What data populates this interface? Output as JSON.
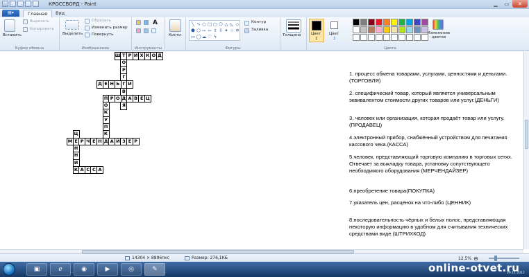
{
  "window": {
    "title": "КРОССВОРД - Paint"
  },
  "menu": {
    "file_tab": "▤▾",
    "tabs": [
      {
        "label": "Главная"
      },
      {
        "label": "Вид"
      }
    ]
  },
  "ribbon": {
    "clipboard": {
      "label": "Буфер обмена",
      "paste": "Вставить",
      "cut": "Вырезать",
      "copy": "Копировать"
    },
    "image": {
      "label": "Изображение",
      "select": "Выделить",
      "crop": "Обрезать",
      "resize": "Изменить размер",
      "rotate": "Повернуть"
    },
    "tools": {
      "label": "Инструменты",
      "text_tool": "A"
    },
    "brushes": {
      "label": "Кисти"
    },
    "shapes": {
      "label": "Фигуры",
      "outline": "Контур",
      "fill": "Заливка"
    },
    "size": {
      "label": "Толщина"
    },
    "colors": {
      "label": "Цвета",
      "color1": "Цвет",
      "color1_num": "1",
      "color2": "Цвет",
      "color2_num": "2",
      "edit": "Изменение цветов",
      "color1_value": "#000000",
      "color2_value": "#ffffff",
      "palette": [
        "#000000",
        "#7f7f7f",
        "#880015",
        "#ed1c24",
        "#ff7f27",
        "#fff200",
        "#22b14c",
        "#00a2e8",
        "#3f48cc",
        "#a349a4",
        "#ffffff",
        "#c3c3c3",
        "#b97a57",
        "#ffaec9",
        "#ffc90e",
        "#efe4b0",
        "#b5e61d",
        "#99d9ea",
        "#7092be",
        "#c8bfe7",
        "#ffffff",
        "#ffffff",
        "#ffffff",
        "#ffffff",
        "#ffffff",
        "#ffffff",
        "#ffffff",
        "#ffffff",
        "#ffffff",
        "#ffffff"
      ]
    }
  },
  "crossword": {
    "words": [
      {
        "id": "shtrikhkod",
        "text": "ШТРИХКОД",
        "dir": "across",
        "row": 0,
        "col": 8
      },
      {
        "id": "torgovlya",
        "text": "ТОРГОВЛЯ",
        "dir": "down",
        "row": 0,
        "col": 9
      },
      {
        "id": "dengi",
        "text": "ДЕНЬГИ",
        "dir": "across",
        "row": 4,
        "col": 5
      },
      {
        "id": "prodavets",
        "text": "ПРОДАВЕЦ",
        "dir": "across",
        "row": 6,
        "col": 6
      },
      {
        "id": "pokupka",
        "text": "ПОКУПКА",
        "dir": "down",
        "row": 6,
        "col": 6
      },
      {
        "id": "merchandayzer",
        "text": "МЕРЧЕНДАЙЗЕР",
        "dir": "across",
        "row": 12,
        "col": 0
      },
      {
        "id": "tsennik",
        "text": "ЦЕННИК",
        "dir": "down",
        "row": 11,
        "col": 1
      },
      {
        "id": "kassa",
        "text": "КАССА",
        "dir": "across",
        "row": 16,
        "col": 1
      }
    ]
  },
  "clues": [
    {
      "text": "1. процесс обмена товарами, услугами, ценностями и деньгами.  (ТОРГОВЛЯ)"
    },
    {
      "text": "2. специфический товар, который является универсальным эквивалентом стоимости других товаров или услуг.(ДЕНЬГИ)"
    },
    {
      "text": "3. человек или организация, которая продаёт товар или услугу.(ПРОДАВЕЦ)"
    },
    {
      "text": "4.электронный прибор, снабжённый устройством для печатания кассового чека.(КАССА)"
    },
    {
      "text": "5.человек, представляющий торговую компанию в торговых сетях. Отвечает за выкладку товара, установку сопутствующего необходимого оборудования (МЕРЧЕНДАЙЗЕР)"
    },
    {
      "text": "6.преобретение товара(ПОКУПКА)"
    },
    {
      "text": "7.указатель цен, расценок на что-либо (ЦЕННИК)"
    },
    {
      "text": "8.последовательность чёрных и белых полос, представляющая некоторую информацию в удобном для считывания технических средствами виде.(ШТРИХКОД)"
    }
  ],
  "status": {
    "size": "14304 × 8896пкс",
    "filesize": "Размер: 276,1КБ",
    "zoom": "12,5%"
  },
  "taskbar": {
    "watermark": "online-otvet.ru",
    "date": "29.11.2012"
  }
}
